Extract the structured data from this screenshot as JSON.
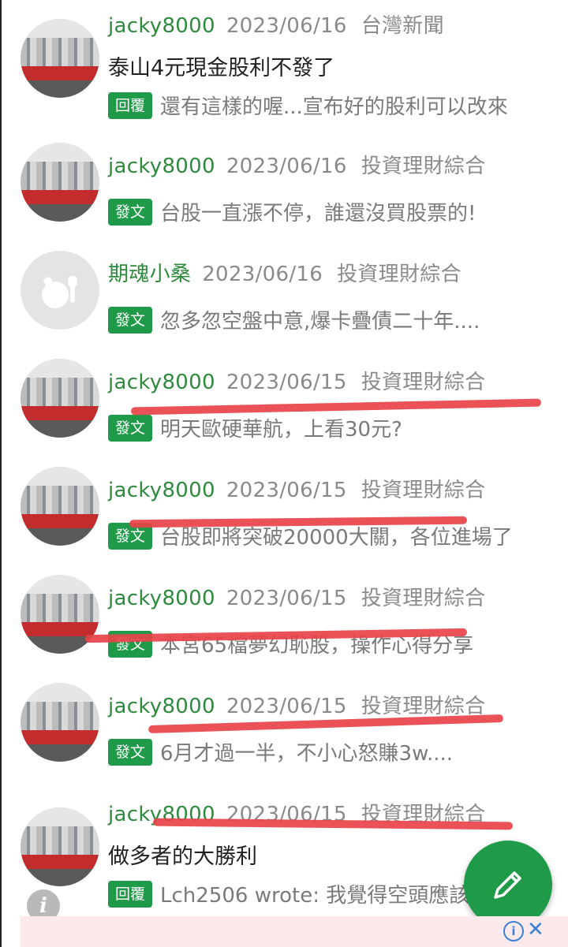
{
  "posts": [
    {
      "author": "jacky8000",
      "date": "2023/06/16",
      "board": "台灣新聞",
      "title": "泰山4元現金股利不發了",
      "badge": "回覆",
      "snippet": "還有這樣的喔...宣布好的股利可以改來"
    },
    {
      "author": "jacky8000",
      "date": "2023/06/16",
      "board": "投資理財綜合",
      "badge": "發文",
      "snippet": "台股一直漲不停，誰還沒買股票的!"
    },
    {
      "author": "期魂小桑",
      "date": "2023/06/16",
      "board": "投資理財綜合",
      "badge": "發文",
      "snippet": "忽多忽空盤中意,爆卡疊債二十年...."
    },
    {
      "author": "jacky8000",
      "date": "2023/06/15",
      "board": "投資理財綜合",
      "badge": "發文",
      "snippet": "明天歐硬華航，上看30元?"
    },
    {
      "author": "jacky8000",
      "date": "2023/06/15",
      "board": "投資理財綜合",
      "badge": "發文",
      "snippet": "台股即將突破20000大關，各位進場了"
    },
    {
      "author": "jacky8000",
      "date": "2023/06/15",
      "board": "投資理財綜合",
      "badge": "發文",
      "snippet": "本宮65檔夢幻恥股，操作心得分享"
    },
    {
      "author": "jacky8000",
      "date": "2023/06/15",
      "board": "投資理財綜合",
      "badge": "發文",
      "snippet": "6月才過一半，不小心怒賺3w...."
    },
    {
      "author": "jacky8000",
      "date": "2023/06/15",
      "board": "投資理財綜合",
      "title": "做多者的大勝利",
      "badge": "回覆",
      "snippet": "Lch2506 wrote: 我覺得空頭應該"
    }
  ],
  "fab": {
    "icon": "pencil-icon"
  },
  "ad": {
    "info_icon": "info-icon",
    "close_glyph": "✕"
  },
  "info_badge": {
    "glyph": "i"
  },
  "colors": {
    "brand_green": "#1f9a48",
    "annotation_red": "#e8434a"
  }
}
